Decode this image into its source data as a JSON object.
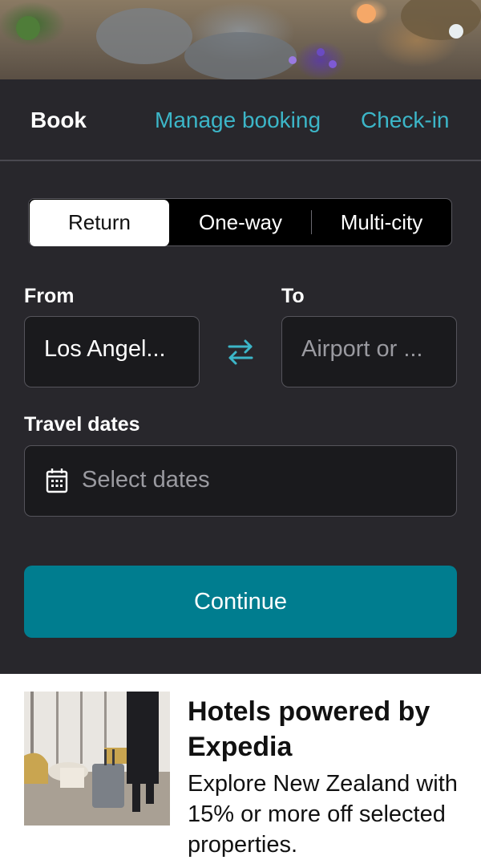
{
  "tabs": {
    "book": "Book",
    "manage": "Manage booking",
    "checkin": "Check-in"
  },
  "trip_type": {
    "options": [
      "Return",
      "One-way",
      "Multi-city"
    ],
    "selected": "Return"
  },
  "form": {
    "from_label": "From",
    "from_value": "Los Angel...",
    "to_label": "To",
    "to_placeholder": "Airport or ...",
    "dates_label": "Travel dates",
    "dates_placeholder": "Select dates",
    "continue_label": "Continue"
  },
  "promo": {
    "title": "Hotels powered by Expedia",
    "description": "Explore New Zealand with 15% or more off selected properties."
  },
  "icons": {
    "swap": "swap-arrows-icon",
    "calendar": "calendar-icon"
  },
  "colors": {
    "panel_bg": "#28272c",
    "accent": "#3cb6c8",
    "button": "#007d8f"
  }
}
